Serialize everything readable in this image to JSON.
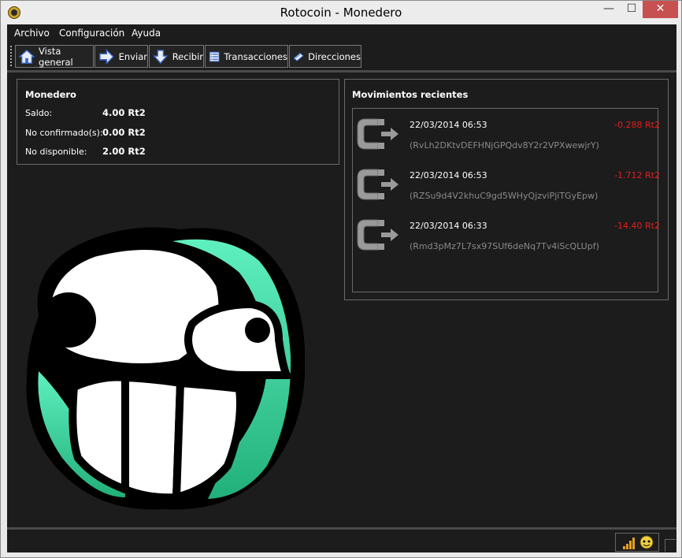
{
  "window": {
    "title": "Rotocoin - Monedero",
    "minimize": "—",
    "maximize": "☐",
    "close": "✕"
  },
  "menu": {
    "items": [
      "Archivo",
      "Configuración",
      "Ayuda"
    ]
  },
  "toolbar": {
    "buttons": [
      {
        "label": "Vista general",
        "icon": "home-icon"
      },
      {
        "label": "Enviar",
        "icon": "send-arrow-icon"
      },
      {
        "label": "Recibir",
        "icon": "receive-arrow-icon"
      },
      {
        "label": "Transacciones",
        "icon": "transactions-list-icon"
      },
      {
        "label": "Direcciones",
        "icon": "address-book-icon"
      }
    ]
  },
  "wallet": {
    "title": "Monedero",
    "rows": [
      {
        "label": "Saldo:",
        "value": "4.00 Rt2"
      },
      {
        "label": "No confirmado(s):",
        "value": "0.00 Rt2"
      },
      {
        "label": "No disponible:",
        "value": "2.00 Rt2"
      }
    ]
  },
  "recent": {
    "title": "Movimientos recientes",
    "transactions": [
      {
        "date": "22/03/2014 06:53",
        "amount": "-0.288 Rt2",
        "address": "(RvLh2DKtvDEFHNjGPQdv8Y2r2VPXwewjrY)"
      },
      {
        "date": "22/03/2014 06:53",
        "amount": "-1.712 Rt2",
        "address": "(RZSu9d4V2khuC9gd5WHyQjzviPjiTGyEpw)"
      },
      {
        "date": "22/03/2014 06:33",
        "amount": "-14.40 Rt2",
        "address": "(Rmd3pMz7L7sx97SUf6deNq7Tv4iScQLUpf)"
      }
    ]
  },
  "colors": {
    "background": "#1c1c1c",
    "accent": "#3ddc97",
    "negative": "#e02020",
    "address": "#8a8a8a"
  },
  "status": {
    "icons": [
      "connection-bars-icon",
      "sync-status-icon"
    ]
  }
}
